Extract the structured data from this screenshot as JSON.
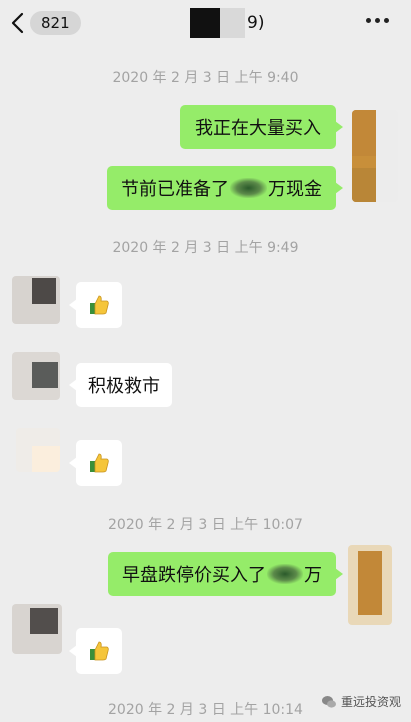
{
  "header": {
    "unread_count": "821",
    "title_suffix": "9)"
  },
  "messages": {
    "ts1": "2020 年 2 月 3 日  上午 9:40",
    "m1": "我正在大量买入",
    "m2_pre": "节前已准备了",
    "m2_post": "万现金",
    "ts2": "2020 年 2 月 3 日  上午 9:49",
    "m5": "积极救市",
    "ts3": "2020 年 2 月 3 日  上午 10:07",
    "m7_pre": "早盘跌停价买入了",
    "m7_post": "万",
    "ts4": "2020 年 2 月 3 日  上午 10:14"
  },
  "icons": {
    "back": "chevron-left-icon",
    "more": "more-dots-icon",
    "thumbs_up": "thumbs-up-emoji-icon"
  },
  "colors": {
    "background": "#ededed",
    "sent_bubble": "#95ec69",
    "received_bubble": "#ffffff",
    "timestamp": "#a3a3a3"
  },
  "watermark": {
    "text": "重远投资观"
  }
}
